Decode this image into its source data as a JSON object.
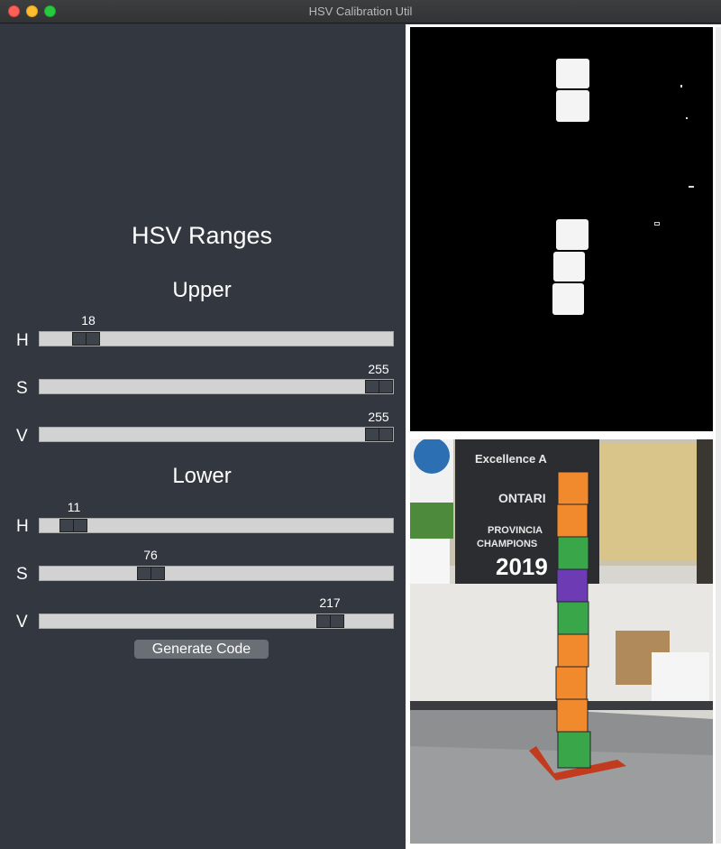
{
  "window": {
    "title": "HSV Calibration Util"
  },
  "panel": {
    "title": "HSV Ranges",
    "upper_label": "Upper",
    "lower_label": "Lower",
    "upper": {
      "h": {
        "label": "H",
        "value": "18",
        "max": 179
      },
      "s": {
        "label": "S",
        "value": "255",
        "max": 255
      },
      "v": {
        "label": "V",
        "value": "255",
        "max": 255
      }
    },
    "lower": {
      "h": {
        "label": "H",
        "value": "11",
        "max": 179
      },
      "s": {
        "label": "S",
        "value": "76",
        "max": 255
      },
      "v": {
        "label": "V",
        "value": "217",
        "max": 255
      }
    },
    "generate_label": "Generate Code"
  },
  "images": {
    "camera_banner_lines": [
      "Excellence A",
      "ONTARI",
      "PROVINCIA",
      "CHAMPIONS",
      "2019"
    ]
  },
  "colors": {
    "background": "#333840",
    "slider_track": "#d2d2d2",
    "slider_thumb": "#3d424b"
  }
}
